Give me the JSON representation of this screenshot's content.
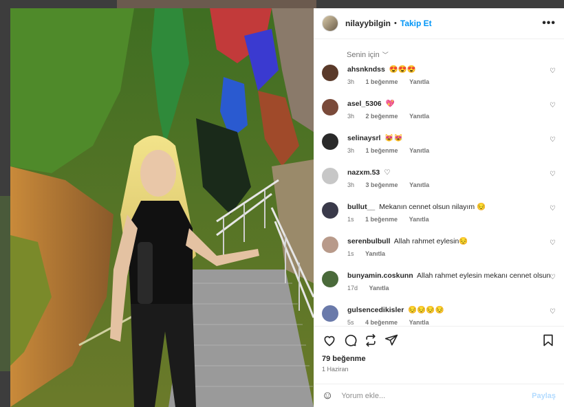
{
  "post": {
    "username": "nilayybilgin",
    "dot": "•",
    "follow_label": "Takip Et",
    "more_label": "•••",
    "filter_label": "Senin için",
    "likes_text": "79 beğenme",
    "date_text": "1 Haziran",
    "comment_placeholder": "Yorum ekle...",
    "post_label": "Paylaş"
  },
  "comments": [
    {
      "user": "ahsnkndss",
      "text": "😍😍😍",
      "time": "3h",
      "likes": "1 beğenme",
      "reply": "Yanıtla",
      "avatar_color": "#5a3a2a"
    },
    {
      "user": "asel_5306",
      "text": "💖",
      "time": "3h",
      "likes": "2 beğenme",
      "reply": "Yanıtla",
      "avatar_color": "#7a4a3a"
    },
    {
      "user": "selinaysrl",
      "text": "😻😻",
      "time": "3h",
      "likes": "1 beğenme",
      "reply": "Yanıtla",
      "avatar_color": "#2a2a2a"
    },
    {
      "user": "nazxm.53",
      "text": "♡",
      "time": "3h",
      "likes": "3 beğenme",
      "reply": "Yanıtla",
      "avatar_color": "#c7c7c7"
    },
    {
      "user": "bullut__",
      "text": "Mekanın cennet olsun nilayım 😔",
      "time": "1s",
      "likes": "1 beğenme",
      "reply": "Yanıtla",
      "avatar_color": "#3a3a4a"
    },
    {
      "user": "serenbulbull",
      "text": "Allah rahmet eylesin😔",
      "time": "1s",
      "likes": "",
      "reply": "Yanıtla",
      "avatar_color": "#b89a8a"
    },
    {
      "user": "bunyamin.coskunn",
      "text": "Allah rahmet eylesin mekanı cennet olsun",
      "time": "17d",
      "likes": "",
      "reply": "Yanıtla",
      "avatar_color": "#4a6a3a"
    },
    {
      "user": "gulsencedikisler",
      "text": "😔😔😔😔",
      "time": "5s",
      "likes": "4 beğenme",
      "reply": "Yanıtla",
      "avatar_color": "#6a7aaa"
    }
  ]
}
